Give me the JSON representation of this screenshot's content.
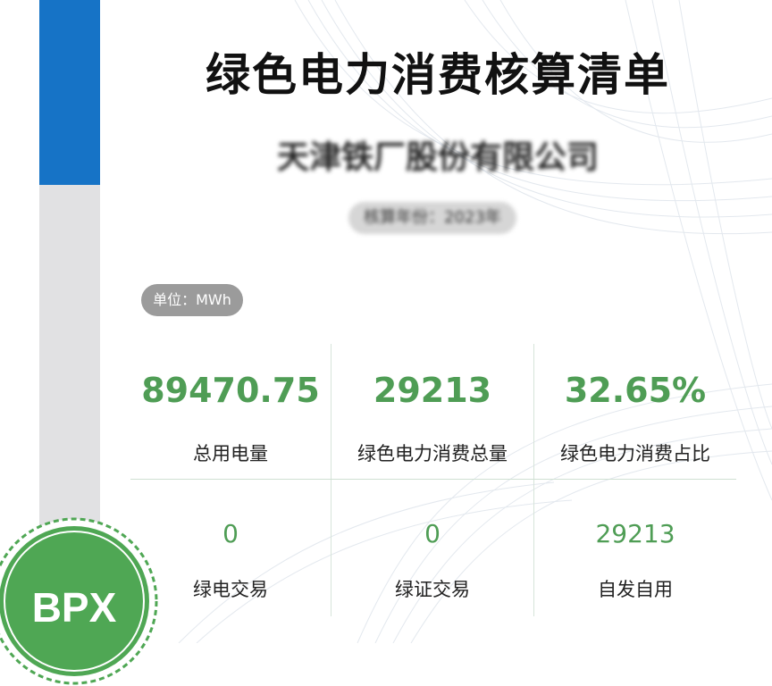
{
  "header": {
    "title": "绿色电力消费核算清单",
    "company": "天津铁厂股份有限公司",
    "period": "核算年份：2023年"
  },
  "unit": "单位：MWh",
  "metrics": [
    {
      "value": "89470.75",
      "label": "总用电量"
    },
    {
      "value": "29213",
      "label": "绿色电力消费总量"
    },
    {
      "value": "32.65%",
      "label": "绿色电力消费占比"
    },
    {
      "value": "0",
      "label": "绿电交易"
    },
    {
      "value": "0",
      "label": "绿证交易"
    },
    {
      "value": "29213",
      "label": "自发自用"
    }
  ],
  "logo": {
    "text": "BPX",
    "color": "#4fa754"
  },
  "colors": {
    "accent_green": "#4f9d55",
    "side_blue": "#1673c6",
    "side_grey": "#e1e1e3"
  }
}
